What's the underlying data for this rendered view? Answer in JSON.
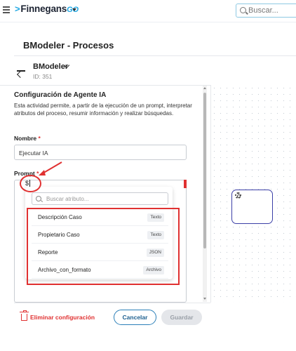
{
  "app": {
    "logo_main": "Finnegans",
    "logo_suffix": "GO",
    "search_placeholder": "Buscar..."
  },
  "page": {
    "title": "BModeler - Procesos"
  },
  "process": {
    "name": "BModeler",
    "id_label": "ID: 351"
  },
  "config": {
    "section_title": "Configuración de Agente IA",
    "description": "Esta actividad permite, a partir de la ejecución de un prompt, interpretar atributos del proceso, resumir información y realizar búsquedas.",
    "name_label": "Nombre",
    "name_required": "*",
    "name_value": "Ejecutar IA",
    "prompt_label": "Prompt",
    "prompt_required": "*",
    "prompt_value": "$"
  },
  "attribute_dropdown": {
    "search_placeholder": "Buscar atributo...",
    "items": [
      {
        "name": "Descripción Caso",
        "type": "Texto"
      },
      {
        "name": "Propietario Caso",
        "type": "Texto"
      },
      {
        "name": "Reporte",
        "type": "JSON"
      },
      {
        "name": "Archivo_con_formato",
        "type": "Archivo"
      }
    ]
  },
  "footer": {
    "delete_label": "Eliminar configuración",
    "cancel_label": "Cancelar",
    "save_label": "Guardar"
  },
  "colors": {
    "accent": "#1fa7e3",
    "annotation_red": "#e03131",
    "task_border": "#3b3fa7"
  }
}
